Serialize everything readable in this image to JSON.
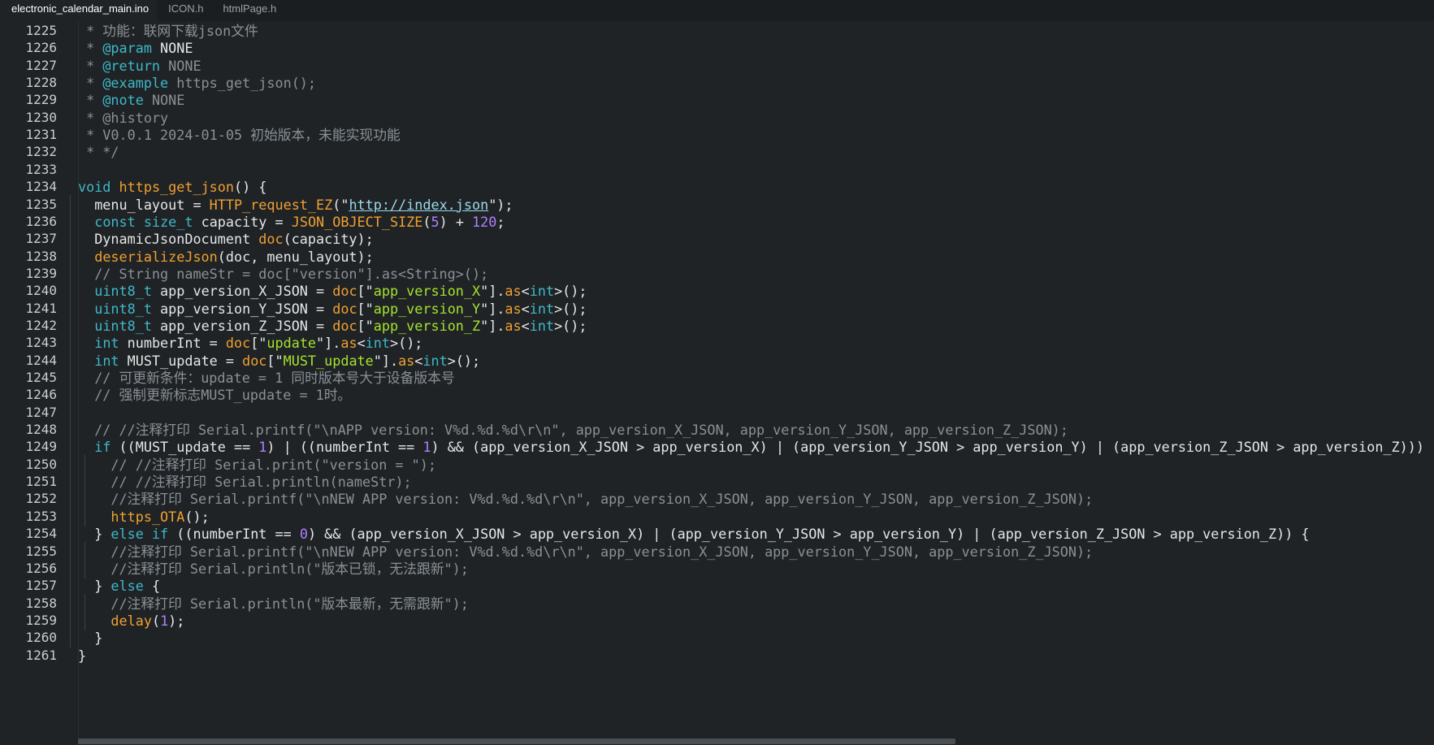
{
  "tabs": [
    {
      "label": "electronic_calendar_main.ino",
      "active": true
    },
    {
      "label": "ICON.h",
      "active": false
    },
    {
      "label": "htmlPage.h",
      "active": false
    }
  ],
  "colors": {
    "plain": "#e6e6e6",
    "comment": "#8a9095",
    "keyword": "#3fb8c8",
    "function": "#f0a030",
    "string": "#a6e22e",
    "number": "#ae81ff",
    "link": "#9cd9ea"
  },
  "lines": [
    {
      "n": "1225",
      "indent": 0,
      "tokens": [
        {
          "t": " * 功能：联网下载json文件",
          "c": "comment"
        }
      ]
    },
    {
      "n": "1226",
      "indent": 0,
      "tokens": [
        {
          "t": " * ",
          "c": "comment"
        },
        {
          "t": "@param",
          "c": "keyword"
        },
        {
          "t": " NONE",
          "c": "plain"
        }
      ]
    },
    {
      "n": "1227",
      "indent": 0,
      "tokens": [
        {
          "t": " * ",
          "c": "comment"
        },
        {
          "t": "@return",
          "c": "keyword"
        },
        {
          "t": " NONE",
          "c": "comment"
        }
      ]
    },
    {
      "n": "1228",
      "indent": 0,
      "tokens": [
        {
          "t": " * ",
          "c": "comment"
        },
        {
          "t": "@example",
          "c": "keyword"
        },
        {
          "t": " https_get_json();",
          "c": "comment"
        }
      ]
    },
    {
      "n": "1229",
      "indent": 0,
      "tokens": [
        {
          "t": " * ",
          "c": "comment"
        },
        {
          "t": "@note",
          "c": "keyword"
        },
        {
          "t": " NONE",
          "c": "comment"
        }
      ]
    },
    {
      "n": "1230",
      "indent": 0,
      "tokens": [
        {
          "t": " * @history",
          "c": "comment"
        }
      ]
    },
    {
      "n": "1231",
      "indent": 0,
      "tokens": [
        {
          "t": " * V0.0.1 2024-01-05 初始版本，未能实现功能",
          "c": "comment"
        }
      ]
    },
    {
      "n": "1232",
      "indent": 0,
      "tokens": [
        {
          "t": " * */",
          "c": "comment"
        }
      ]
    },
    {
      "n": "1233",
      "indent": 0,
      "tokens": []
    },
    {
      "n": "1234",
      "indent": 0,
      "tokens": [
        {
          "t": "void",
          "c": "keyword"
        },
        {
          "t": " ",
          "c": "plain"
        },
        {
          "t": "https_get_json",
          "c": "function"
        },
        {
          "t": "() {",
          "c": "plain"
        }
      ]
    },
    {
      "n": "1235",
      "indent": 1,
      "tokens": [
        {
          "t": "  menu_layout = ",
          "c": "plain"
        },
        {
          "t": "HTTP_request_EZ",
          "c": "function"
        },
        {
          "t": "(\"",
          "c": "plain"
        },
        {
          "t": "http://index.json",
          "c": "link",
          "u": true
        },
        {
          "t": "\");",
          "c": "plain"
        }
      ]
    },
    {
      "n": "1236",
      "indent": 1,
      "tokens": [
        {
          "t": "  ",
          "c": "plain"
        },
        {
          "t": "const",
          "c": "keyword"
        },
        {
          "t": " ",
          "c": "plain"
        },
        {
          "t": "size_t",
          "c": "keyword"
        },
        {
          "t": " capacity = ",
          "c": "plain"
        },
        {
          "t": "JSON_OBJECT_SIZE",
          "c": "function"
        },
        {
          "t": "(",
          "c": "plain"
        },
        {
          "t": "5",
          "c": "number"
        },
        {
          "t": ") + ",
          "c": "plain"
        },
        {
          "t": "120",
          "c": "number"
        },
        {
          "t": ";",
          "c": "plain"
        }
      ]
    },
    {
      "n": "1237",
      "indent": 1,
      "tokens": [
        {
          "t": "  DynamicJsonDocument ",
          "c": "plain"
        },
        {
          "t": "doc",
          "c": "function"
        },
        {
          "t": "(capacity);",
          "c": "plain"
        }
      ]
    },
    {
      "n": "1238",
      "indent": 1,
      "tokens": [
        {
          "t": "  ",
          "c": "plain"
        },
        {
          "t": "deserializeJson",
          "c": "function"
        },
        {
          "t": "(doc, menu_layout);",
          "c": "plain"
        }
      ]
    },
    {
      "n": "1239",
      "indent": 1,
      "tokens": [
        {
          "t": "  // String nameStr = doc[\"version\"].as<String>();",
          "c": "comment"
        }
      ]
    },
    {
      "n": "1240",
      "indent": 1,
      "tokens": [
        {
          "t": "  ",
          "c": "plain"
        },
        {
          "t": "uint8_t",
          "c": "keyword"
        },
        {
          "t": " app_version_X_JSON = ",
          "c": "plain"
        },
        {
          "t": "doc",
          "c": "function"
        },
        {
          "t": "[\"",
          "c": "plain"
        },
        {
          "t": "app_version_X",
          "c": "string"
        },
        {
          "t": "\"].",
          "c": "plain"
        },
        {
          "t": "as",
          "c": "function"
        },
        {
          "t": "<",
          "c": "plain"
        },
        {
          "t": "int",
          "c": "keyword"
        },
        {
          "t": ">();",
          "c": "plain"
        }
      ]
    },
    {
      "n": "1241",
      "indent": 1,
      "tokens": [
        {
          "t": "  ",
          "c": "plain"
        },
        {
          "t": "uint8_t",
          "c": "keyword"
        },
        {
          "t": " app_version_Y_JSON = ",
          "c": "plain"
        },
        {
          "t": "doc",
          "c": "function"
        },
        {
          "t": "[\"",
          "c": "plain"
        },
        {
          "t": "app_version_Y",
          "c": "string"
        },
        {
          "t": "\"].",
          "c": "plain"
        },
        {
          "t": "as",
          "c": "function"
        },
        {
          "t": "<",
          "c": "plain"
        },
        {
          "t": "int",
          "c": "keyword"
        },
        {
          "t": ">();",
          "c": "plain"
        }
      ]
    },
    {
      "n": "1242",
      "indent": 1,
      "tokens": [
        {
          "t": "  ",
          "c": "plain"
        },
        {
          "t": "uint8_t",
          "c": "keyword"
        },
        {
          "t": " app_version_Z_JSON = ",
          "c": "plain"
        },
        {
          "t": "doc",
          "c": "function"
        },
        {
          "t": "[\"",
          "c": "plain"
        },
        {
          "t": "app_version_Z",
          "c": "string"
        },
        {
          "t": "\"].",
          "c": "plain"
        },
        {
          "t": "as",
          "c": "function"
        },
        {
          "t": "<",
          "c": "plain"
        },
        {
          "t": "int",
          "c": "keyword"
        },
        {
          "t": ">();",
          "c": "plain"
        }
      ]
    },
    {
      "n": "1243",
      "indent": 1,
      "tokens": [
        {
          "t": "  ",
          "c": "plain"
        },
        {
          "t": "int",
          "c": "keyword"
        },
        {
          "t": " numberInt = ",
          "c": "plain"
        },
        {
          "t": "doc",
          "c": "function"
        },
        {
          "t": "[\"",
          "c": "plain"
        },
        {
          "t": "update",
          "c": "string"
        },
        {
          "t": "\"].",
          "c": "plain"
        },
        {
          "t": "as",
          "c": "function"
        },
        {
          "t": "<",
          "c": "plain"
        },
        {
          "t": "int",
          "c": "keyword"
        },
        {
          "t": ">();",
          "c": "plain"
        }
      ]
    },
    {
      "n": "1244",
      "indent": 1,
      "tokens": [
        {
          "t": "  ",
          "c": "plain"
        },
        {
          "t": "int",
          "c": "keyword"
        },
        {
          "t": " MUST_update = ",
          "c": "plain"
        },
        {
          "t": "doc",
          "c": "function"
        },
        {
          "t": "[\"",
          "c": "plain"
        },
        {
          "t": "MUST_update",
          "c": "string"
        },
        {
          "t": "\"].",
          "c": "plain"
        },
        {
          "t": "as",
          "c": "function"
        },
        {
          "t": "<",
          "c": "plain"
        },
        {
          "t": "int",
          "c": "keyword"
        },
        {
          "t": ">();",
          "c": "plain"
        }
      ]
    },
    {
      "n": "1245",
      "indent": 1,
      "tokens": [
        {
          "t": "  // 可更新条件：update = 1 同时版本号大于设备版本号",
          "c": "comment"
        }
      ]
    },
    {
      "n": "1246",
      "indent": 1,
      "tokens": [
        {
          "t": "  // 强制更新标志MUST_update = 1时。",
          "c": "comment"
        }
      ]
    },
    {
      "n": "1247",
      "indent": 1,
      "tokens": []
    },
    {
      "n": "1248",
      "indent": 1,
      "tokens": [
        {
          "t": "  // //注释打印 Serial.printf(\"\\nAPP version: V%d.%d.%d\\r\\n\", app_version_X_JSON, app_version_Y_JSON, app_version_Z_JSON);",
          "c": "comment"
        }
      ]
    },
    {
      "n": "1249",
      "indent": 1,
      "tokens": [
        {
          "t": "  ",
          "c": "plain"
        },
        {
          "t": "if",
          "c": "keyword"
        },
        {
          "t": " ((MUST_update == ",
          "c": "plain"
        },
        {
          "t": "1",
          "c": "number"
        },
        {
          "t": ") | ((numberInt == ",
          "c": "plain"
        },
        {
          "t": "1",
          "c": "number"
        },
        {
          "t": ") && (app_version_X_JSON > app_version_X) | (app_version_Y_JSON > app_version_Y) | (app_version_Z_JSON > app_version_Z))) {",
          "c": "plain"
        }
      ]
    },
    {
      "n": "1250",
      "indent": 2,
      "tokens": [
        {
          "t": "    // //注释打印 Serial.print(\"version = \");",
          "c": "comment"
        }
      ]
    },
    {
      "n": "1251",
      "indent": 2,
      "tokens": [
        {
          "t": "    // //注释打印 Serial.println(nameStr);",
          "c": "comment"
        }
      ]
    },
    {
      "n": "1252",
      "indent": 2,
      "tokens": [
        {
          "t": "    //注释打印 Serial.printf(\"\\nNEW APP version: V%d.%d.%d\\r\\n\", app_version_X_JSON, app_version_Y_JSON, app_version_Z_JSON);",
          "c": "comment"
        }
      ]
    },
    {
      "n": "1253",
      "indent": 2,
      "tokens": [
        {
          "t": "    ",
          "c": "plain"
        },
        {
          "t": "https_OTA",
          "c": "function"
        },
        {
          "t": "();",
          "c": "plain"
        }
      ]
    },
    {
      "n": "1254",
      "indent": 1,
      "tokens": [
        {
          "t": "  } ",
          "c": "plain"
        },
        {
          "t": "else",
          "c": "keyword"
        },
        {
          "t": " ",
          "c": "plain"
        },
        {
          "t": "if",
          "c": "keyword"
        },
        {
          "t": " ((numberInt == ",
          "c": "plain"
        },
        {
          "t": "0",
          "c": "number"
        },
        {
          "t": ") && (app_version_X_JSON > app_version_X) | (app_version_Y_JSON > app_version_Y) | (app_version_Z_JSON > app_version_Z)) {",
          "c": "plain"
        }
      ]
    },
    {
      "n": "1255",
      "indent": 2,
      "tokens": [
        {
          "t": "    //注释打印 Serial.printf(\"\\nNEW APP version: V%d.%d.%d\\r\\n\", app_version_X_JSON, app_version_Y_JSON, app_version_Z_JSON);",
          "c": "comment"
        }
      ]
    },
    {
      "n": "1256",
      "indent": 2,
      "tokens": [
        {
          "t": "    //注释打印 Serial.println(\"版本已锁，无法跟新\");",
          "c": "comment"
        }
      ]
    },
    {
      "n": "1257",
      "indent": 1,
      "tokens": [
        {
          "t": "  } ",
          "c": "plain"
        },
        {
          "t": "else",
          "c": "keyword"
        },
        {
          "t": " {",
          "c": "plain"
        }
      ]
    },
    {
      "n": "1258",
      "indent": 2,
      "tokens": [
        {
          "t": "    //注释打印 Serial.println(\"版本最新，无需跟新\");",
          "c": "comment"
        }
      ]
    },
    {
      "n": "1259",
      "indent": 2,
      "tokens": [
        {
          "t": "    ",
          "c": "plain"
        },
        {
          "t": "delay",
          "c": "function"
        },
        {
          "t": "(",
          "c": "plain"
        },
        {
          "t": "1",
          "c": "number"
        },
        {
          "t": ");",
          "c": "plain"
        }
      ]
    },
    {
      "n": "1260",
      "indent": 1,
      "tokens": [
        {
          "t": "  }",
          "c": "plain"
        }
      ]
    },
    {
      "n": "1261",
      "indent": 0,
      "tokens": [
        {
          "t": "}",
          "c": "plain"
        }
      ]
    }
  ]
}
